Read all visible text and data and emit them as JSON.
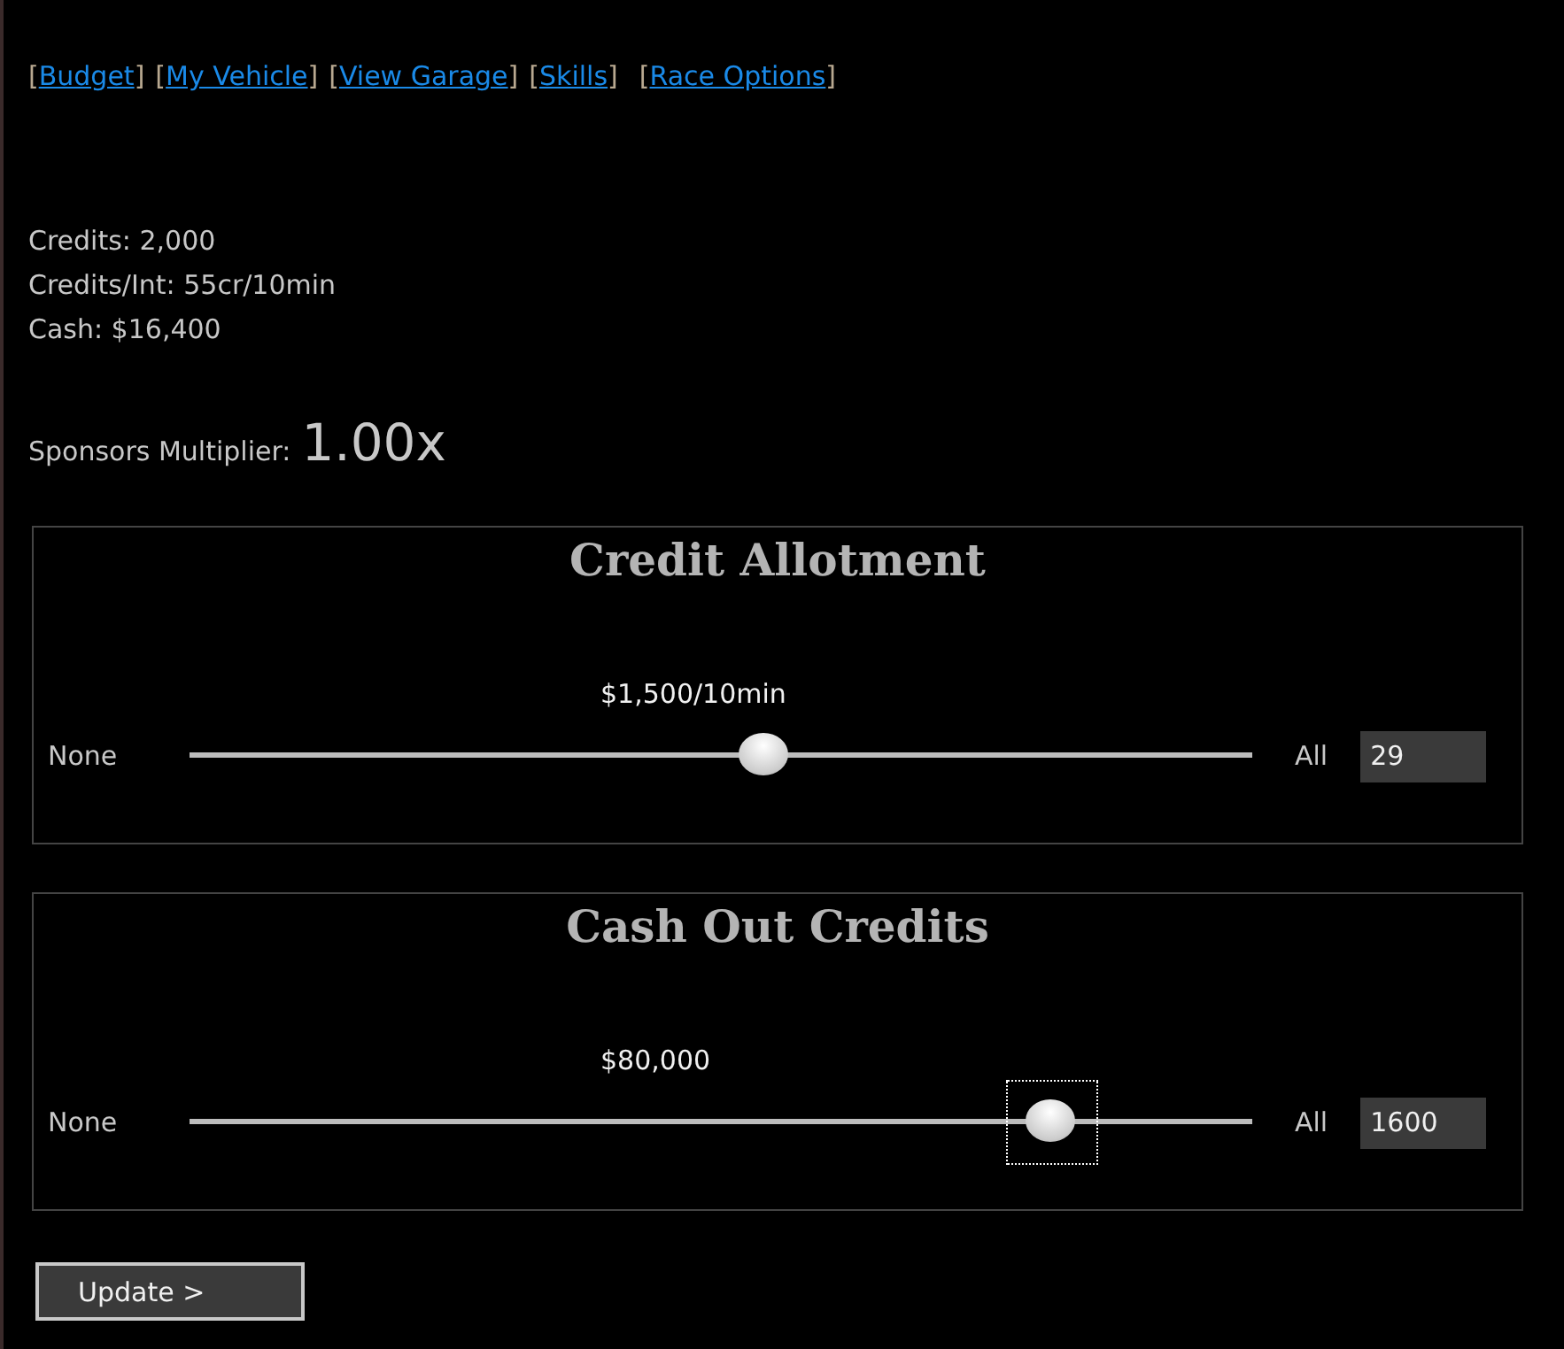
{
  "nav_links": [
    {
      "open": "[",
      "label": "Budget",
      "close": "]"
    },
    {
      "open": "[",
      "label": "My Vehicle",
      "close": "]"
    },
    {
      "open": "[",
      "label": "View Garage",
      "close": "]"
    },
    {
      "open": "[",
      "label": "Skills",
      "close": "]"
    },
    {
      "open": "[",
      "label": "Race Options",
      "close": "]"
    }
  ],
  "stats": [
    "Credits: 2,000",
    "Credits/Int: 55cr/10min",
    "Cash: $16,400"
  ],
  "sponsors": {
    "label": "Sponsors Multiplier:",
    "value": "1.00x"
  },
  "panels": [
    {
      "title": "Credit Allotment",
      "reading": "$1,500/10min",
      "min_label": "None",
      "max_label": "All",
      "level": 0.54,
      "focused": false,
      "value": "29"
    },
    {
      "title": "Cash Out Credits",
      "reading": "$80,000",
      "min_label": "None",
      "max_label": "All",
      "level": 0.81,
      "focused": true,
      "value": "1600"
    }
  ],
  "button": {
    "label": "Update >"
  }
}
